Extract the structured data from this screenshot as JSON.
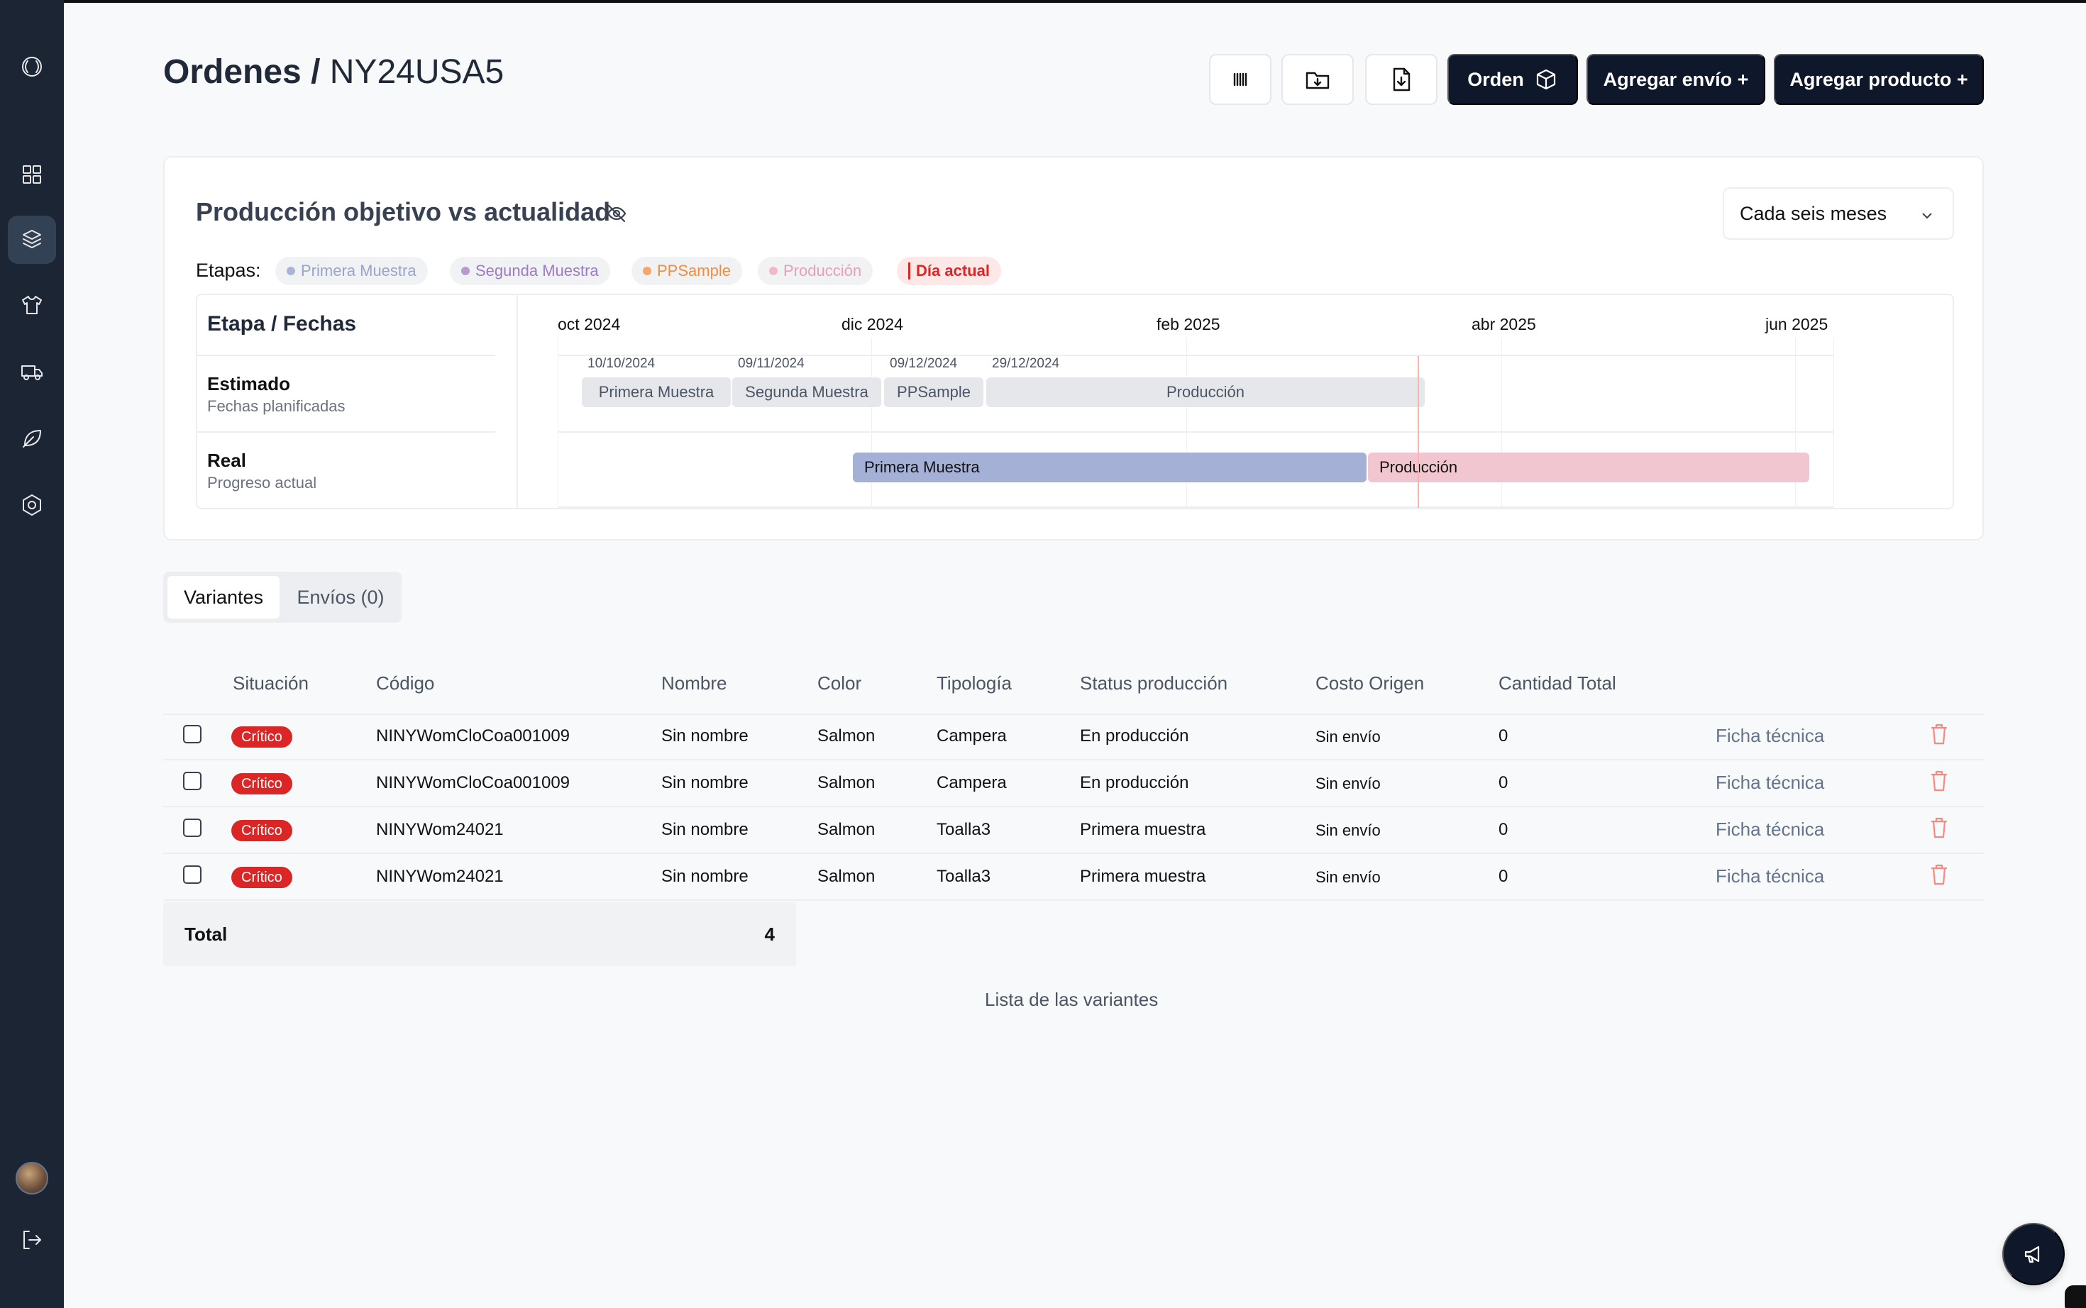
{
  "header": {
    "title_main": "Ordenes /",
    "title_sub": "NY24USA5",
    "buttons": {
      "order_label": "Orden",
      "add_shipment_label": "Agregar envío +",
      "add_product_label": "Agregar producto +"
    },
    "icons": [
      "barcode-icon",
      "folder-download-icon",
      "file-download-icon",
      "package-icon"
    ]
  },
  "sidebar": {
    "items": [
      "logo-icon",
      "dashboard-icon",
      "orders-icon",
      "shirt-icon",
      "truck-icon",
      "leaf-icon",
      "settings-icon"
    ],
    "active": "orders-icon"
  },
  "production_card": {
    "title": "Producción objetivo vs actualidad",
    "period_select": "Cada seis meses",
    "stages_label": "Etapas:",
    "stages": [
      {
        "label": "Primera Muestra",
        "color": "#aab4d6"
      },
      {
        "label": "Segunda Muestra",
        "color": "#b79bd0"
      },
      {
        "label": "PPSample",
        "color": "#f6a66b"
      },
      {
        "label": "Producción",
        "color": "#f2b8c6"
      },
      {
        "label": "Día actual",
        "color": "#dc2626"
      }
    ],
    "gantt": {
      "header": "Etapa / Fechas",
      "months": [
        "oct 2024",
        "dic 2024",
        "feb 2025",
        "abr 2025",
        "jun 2025"
      ],
      "rows": {
        "estimated": {
          "title": "Estimado",
          "subtitle": "Fechas planificadas"
        },
        "real": {
          "title": "Real",
          "subtitle": "Progreso actual"
        }
      },
      "estimated_dates": [
        "10/10/2024",
        "09/11/2024",
        "09/12/2024",
        "29/12/2024"
      ],
      "estimated_bars": [
        "Primera Muestra",
        "Segunda Muestra",
        "PPSample",
        "Producción"
      ],
      "real_bars": [
        {
          "label": "Primera Muestra",
          "color": "#a5b0d6"
        },
        {
          "label": "Producción",
          "color": "#f2c6d1"
        }
      ]
    }
  },
  "tabs": {
    "variants": "Variantes",
    "shipments": "Envíos (0)"
  },
  "table": {
    "columns": [
      "Situación",
      "Código",
      "Nombre",
      "Color",
      "Tipología",
      "Status producción",
      "Costo Origen",
      "Cantidad Total"
    ],
    "rows": [
      {
        "status": "Crítico",
        "code": "NINYWomCloCoa001009",
        "name": "Sin nombre",
        "color": "Salmon",
        "type": "Campera",
        "production": "En producción",
        "cost": "Sin envío",
        "qty": "0",
        "link": "Ficha técnica"
      },
      {
        "status": "Crítico",
        "code": "NINYWomCloCoa001009",
        "name": "Sin nombre",
        "color": "Salmon",
        "type": "Campera",
        "production": "En producción",
        "cost": "Sin envío",
        "qty": "0",
        "link": "Ficha técnica"
      },
      {
        "status": "Crítico",
        "code": "NINYWom24021",
        "name": "Sin nombre",
        "color": "Salmon",
        "type": "Toalla3",
        "production": "Primera muestra",
        "cost": "Sin envío",
        "qty": "0",
        "link": "Ficha técnica"
      },
      {
        "status": "Crítico",
        "code": "NINYWom24021",
        "name": "Sin nombre",
        "color": "Salmon",
        "type": "Toalla3",
        "production": "Primera muestra",
        "cost": "Sin envío",
        "qty": "0",
        "link": "Ficha técnica"
      }
    ],
    "total_label": "Total",
    "total_value": "4",
    "caption": "Lista de las variantes"
  }
}
